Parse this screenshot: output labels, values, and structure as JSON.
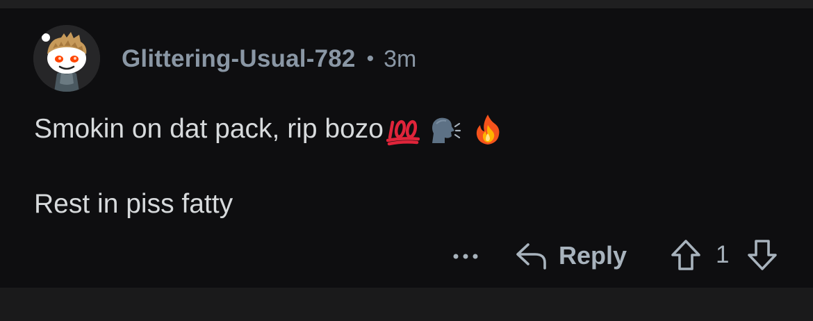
{
  "comment": {
    "author": "Glittering-Usual-782",
    "separator": "•",
    "age": "3m",
    "body_line1": "Smokin on dat pack, rip bozo",
    "body_line1_emojis": [
      "hundred-points-emoji",
      "speaking-head-emoji",
      "fire-emoji"
    ],
    "body_line2": "Rest in piss fatty"
  },
  "actions": {
    "more_icon": "ellipsis-icon",
    "reply_icon": "reply-arrow-icon",
    "reply_label": "Reply",
    "upvote_icon": "upvote-arrow-icon",
    "vote_count": "1",
    "downvote_icon": "downvote-arrow-icon"
  },
  "colors": {
    "background": "#0e0e10",
    "username": "#8a97a5",
    "body_text": "#d7dadc",
    "action_text": "#a8b3bd",
    "hundred_red": "#e0243a"
  }
}
